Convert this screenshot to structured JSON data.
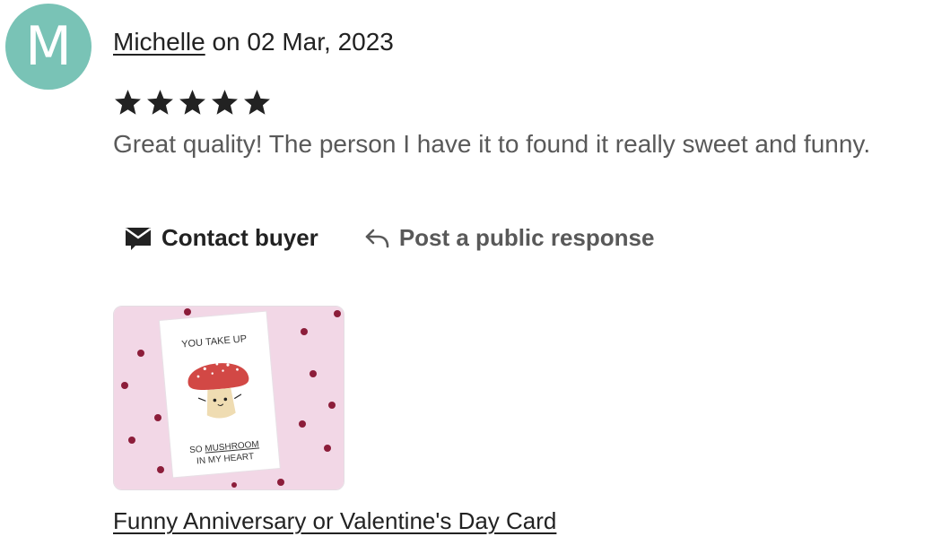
{
  "review": {
    "avatar_initial": "M",
    "reviewer_name": "Michelle",
    "date_text": " on 02 Mar, 2023",
    "rating": 5,
    "text": "Great quality! The person I have it to found it really sweet and funny."
  },
  "actions": {
    "contact_buyer_label": "Contact buyer",
    "public_response_label": "Post a public response"
  },
  "product": {
    "title": "Funny Anniversary or Valentine's Day Card",
    "card_text_top": "YOU TAKE UP",
    "card_text_bottom_prefix": "SO",
    "card_text_bottom_highlight": "MUSHROOM",
    "card_text_bottom_line2": "IN MY HEART"
  },
  "icons": {
    "star": "star-icon",
    "envelope": "envelope-icon",
    "reply": "reply-arrow-icon"
  },
  "colors": {
    "avatar_bg": "#79c3b6",
    "star": "#222222",
    "muted_text": "#595959",
    "thumb_bg": "#f2d7e6"
  }
}
